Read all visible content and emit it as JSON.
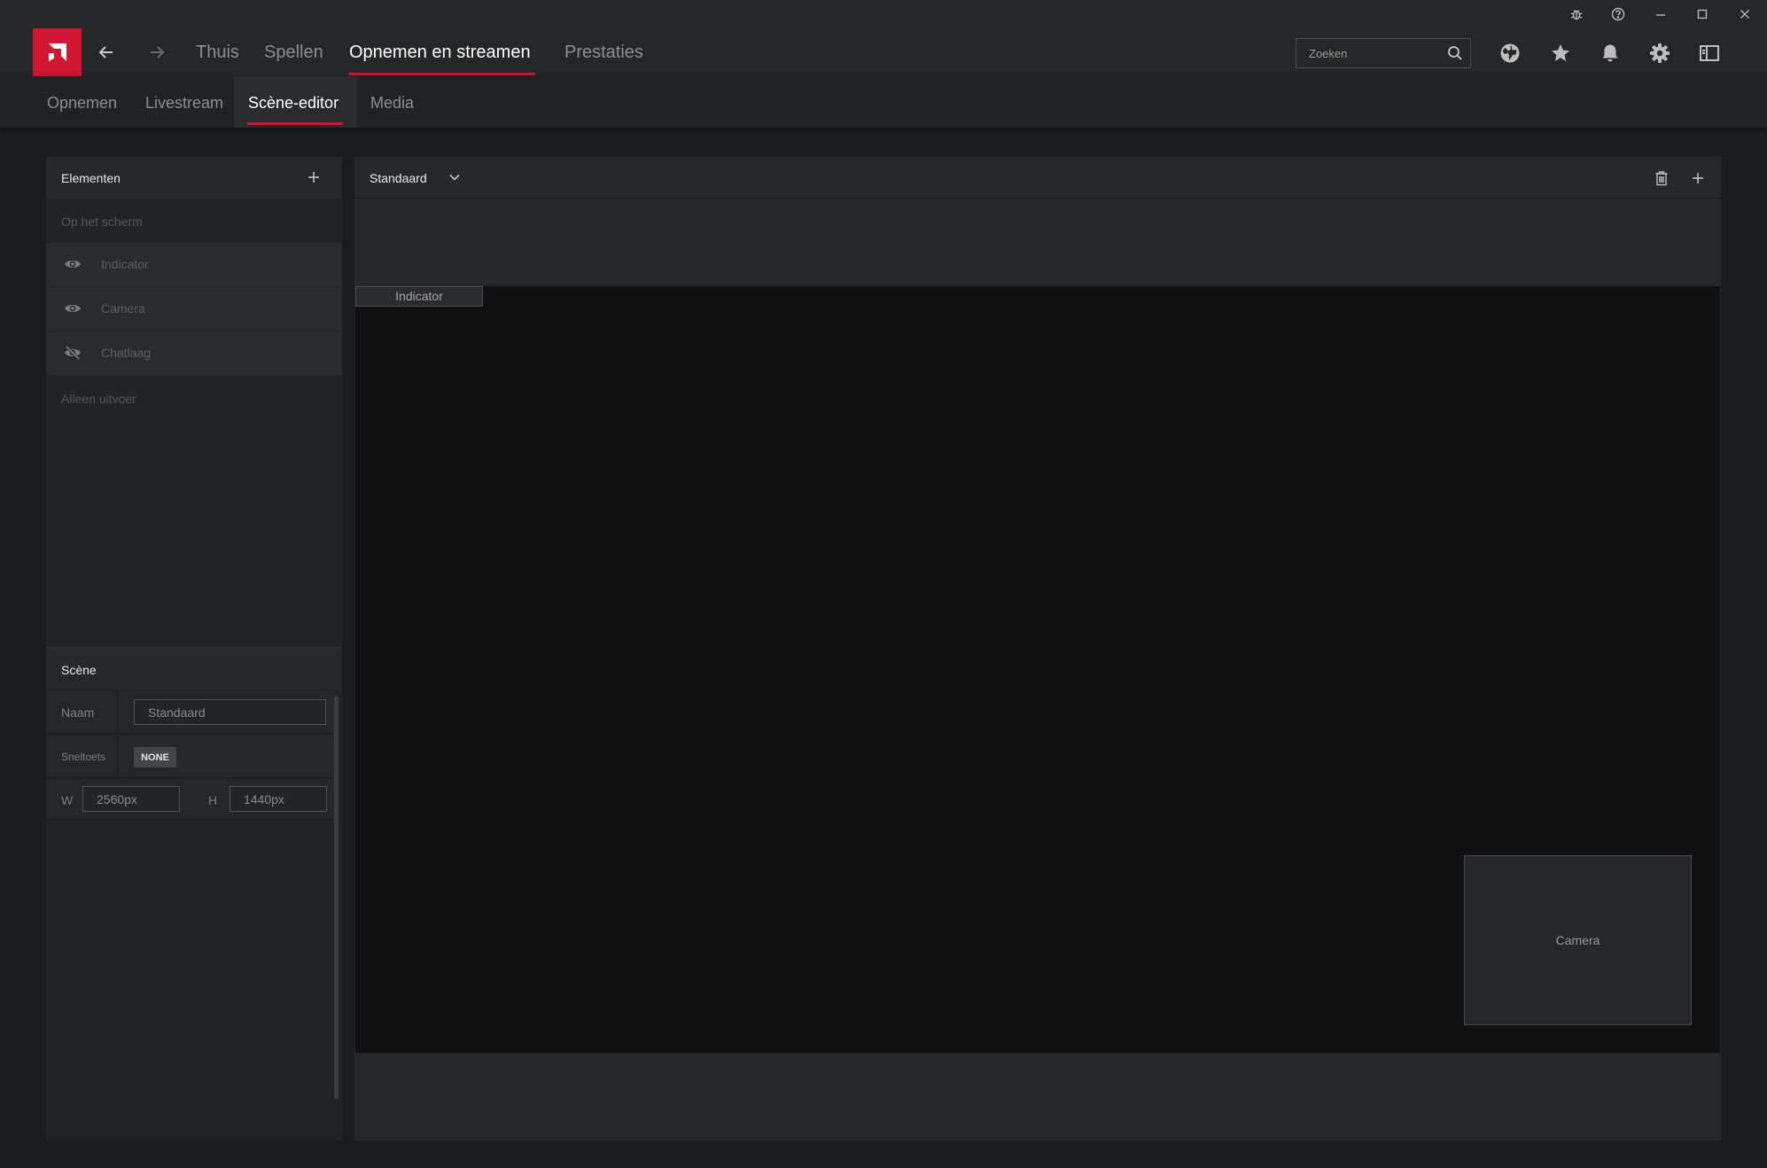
{
  "nav": {
    "items": [
      {
        "label": "Thuis"
      },
      {
        "label": "Spellen"
      },
      {
        "label": "Opnemen en streamen"
      },
      {
        "label": "Prestaties"
      }
    ],
    "active": "Opnemen en streamen"
  },
  "search": {
    "placeholder": "Zoeken",
    "value": ""
  },
  "subnav": {
    "items": [
      {
        "label": "Opnemen"
      },
      {
        "label": "Livestream"
      },
      {
        "label": "Scène-editor"
      },
      {
        "label": "Media"
      }
    ],
    "active": "Scène-editor"
  },
  "elements_panel": {
    "title": "Elementen",
    "on_screen_label": "Op het scherm",
    "items": [
      {
        "label": "Indicator",
        "visible": true
      },
      {
        "label": "Camera",
        "visible": true
      },
      {
        "label": "Chatlaag",
        "visible": false
      }
    ],
    "output_only_label": "Alleen uitvoer"
  },
  "scene_panel": {
    "title": "Scène",
    "name_label": "Naam",
    "name_value": "Standaard",
    "hotkey_label": "Sneltoets",
    "hotkey_value": "NONE",
    "width_label": "W",
    "width_value": "2560px",
    "height_label": "H",
    "height_value": "1440px"
  },
  "editor": {
    "scene_selected": "Standaard",
    "canvas_elements": {
      "indicator": "Indicator",
      "camera": "Camera"
    }
  },
  "colors": {
    "accent": "#d11631",
    "background": "#1b1c1e",
    "panel": "#222325",
    "canvas": "#101010"
  },
  "icons": {
    "titlebar": [
      "bug-icon",
      "help-icon",
      "minimize-icon",
      "maximize-icon",
      "close-icon"
    ],
    "topbar": [
      "globe-icon",
      "star-icon",
      "bell-icon",
      "gear-icon",
      "sidebar-toggle-icon"
    ]
  }
}
